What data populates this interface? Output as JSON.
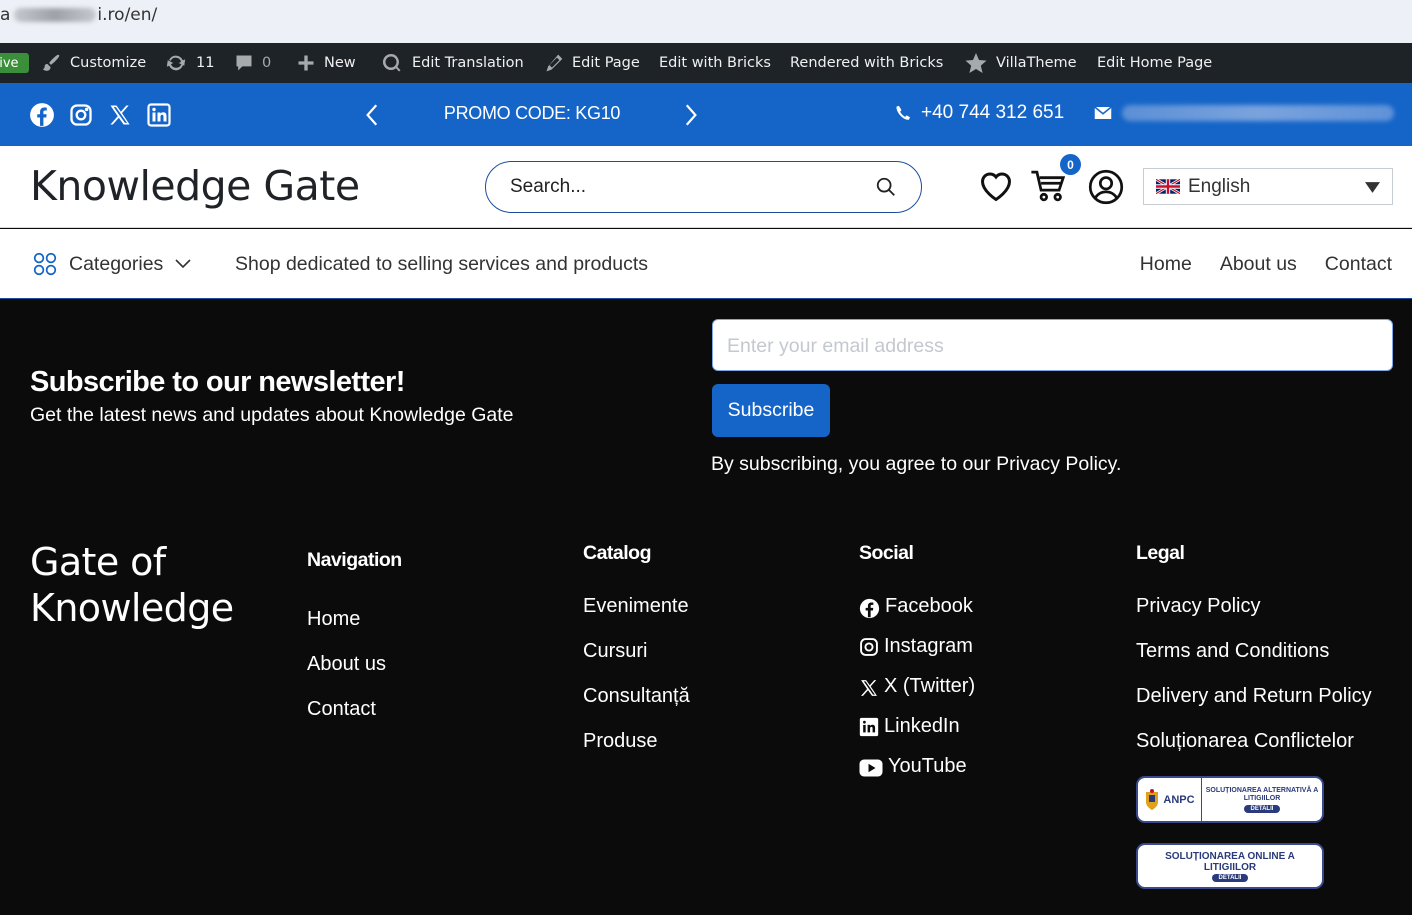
{
  "browser": {
    "url_prefix": "a",
    "url_suffix": "i.ro/en/"
  },
  "adminbar": {
    "live_label": "Live",
    "customize": "Customize",
    "updates_count": "11",
    "comments_count": "0",
    "new": "New",
    "edit_translation": "Edit Translation",
    "edit_page": "Edit Page",
    "edit_with_bricks": "Edit with Bricks",
    "rendered_with_bricks": "Rendered with Bricks",
    "villatheme": "VillaTheme",
    "edit_home_page": "Edit Home Page"
  },
  "promobar": {
    "promo": "PROMO CODE: KG10",
    "phone": "+40 744 312 651",
    "social_icons": [
      "facebook-icon",
      "instagram-icon",
      "x-twitter-icon",
      "linkedin-icon"
    ]
  },
  "header": {
    "logo": "Knowledge Gate",
    "search_placeholder": "Search...",
    "cart_count": "0",
    "language": "English"
  },
  "nav": {
    "categories": "Categories",
    "tagline": "Shop dedicated to selling services and products",
    "links": [
      "Home",
      "About us",
      "Contact"
    ]
  },
  "newsletter": {
    "title": "Subscribe to our newsletter!",
    "subtitle": "Get the latest news and updates about Knowledge Gate",
    "email_placeholder": "Enter your email address",
    "button": "Subscribe",
    "agree": "By subscribing, you agree to our Privacy Policy."
  },
  "footer": {
    "brand_line1": "Gate of",
    "brand_line2": "Knowledge",
    "navigation": {
      "title": "Navigation",
      "items": [
        "Home",
        "About us",
        "Contact"
      ]
    },
    "catalog": {
      "title": "Catalog",
      "items": [
        "Evenimente",
        "Cursuri",
        "Consultanță",
        "Produse"
      ]
    },
    "social": {
      "title": "Social",
      "items": [
        "Facebook",
        "Instagram",
        "X (Twitter)",
        "LinkedIn",
        "YouTube"
      ]
    },
    "legal": {
      "title": "Legal",
      "items": [
        "Privacy Policy",
        "Terms and Conditions",
        "Delivery and Return Policy",
        "Soluționarea Conflictelor"
      ]
    },
    "badge1": {
      "left": "ANPC",
      "title": "SOLUȚIONAREA ALTERNATIVĂ A LITIGIILOR",
      "button": "DETALII"
    },
    "badge2": {
      "title": "SOLUȚIONAREA ONLINE A LITIGIILOR",
      "button": "DETALII"
    }
  },
  "colors": {
    "brand_blue": "#1565c8",
    "adminbar_bg": "#1d2327",
    "footer_bg": "#0b0b0b"
  }
}
